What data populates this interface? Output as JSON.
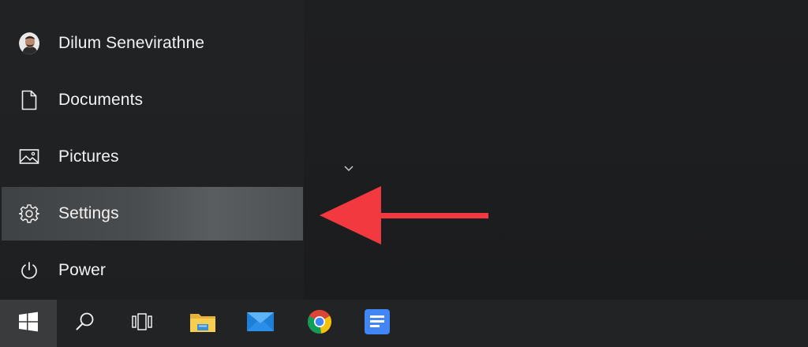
{
  "start_menu": {
    "items": [
      {
        "label": "Dilum Senevirathne",
        "icon": "user-avatar"
      },
      {
        "label": "Documents",
        "icon": "document-icon"
      },
      {
        "label": "Pictures",
        "icon": "picture-icon"
      },
      {
        "label": "Settings",
        "icon": "gear-icon"
      },
      {
        "label": "Power",
        "icon": "power-icon"
      }
    ],
    "active_item": "Settings"
  },
  "taskbar": {
    "buttons": [
      {
        "icon": "windows-logo-icon"
      },
      {
        "icon": "search-icon"
      },
      {
        "icon": "task-view-icon"
      },
      {
        "icon": "file-explorer-icon"
      },
      {
        "icon": "mail-icon"
      },
      {
        "icon": "chrome-icon"
      },
      {
        "icon": "google-docs-icon"
      }
    ]
  },
  "colors": {
    "arrow": "#f2393f",
    "desktop_bg": "#1c1d1f",
    "taskbar_bg": "#222325",
    "highlight": "#4a4d4f"
  }
}
